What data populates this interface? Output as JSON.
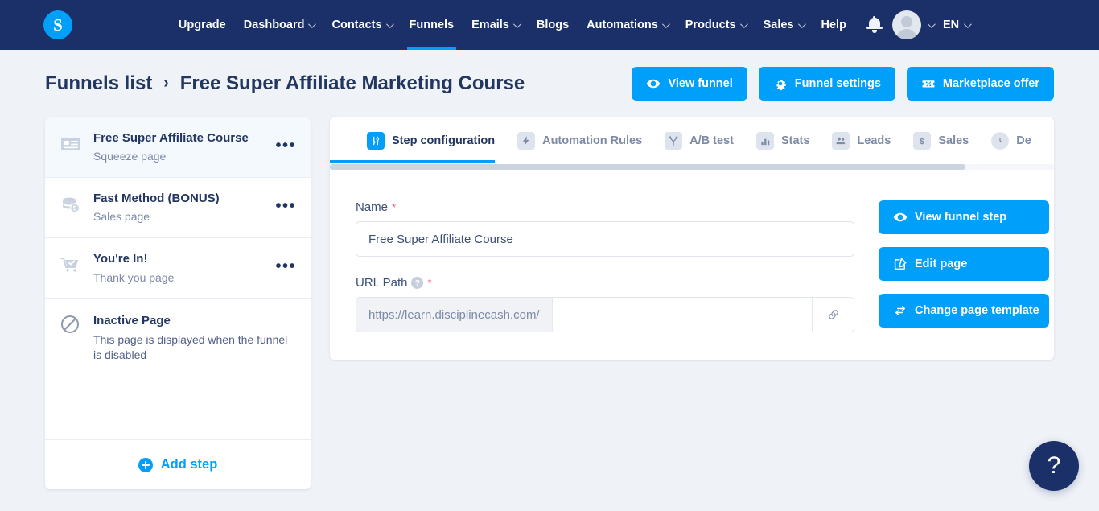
{
  "brand": {
    "logo_letter": "S",
    "accent": "#00a0fa",
    "header_bg": "#1b3068",
    "page_bg": "#eff2f7",
    "required_color": "#f4556c"
  },
  "topnav": {
    "items": [
      {
        "label": "Upgrade",
        "caret": false,
        "active": false
      },
      {
        "label": "Dashboard",
        "caret": true,
        "active": false
      },
      {
        "label": "Contacts",
        "caret": true,
        "active": false
      },
      {
        "label": "Funnels",
        "caret": false,
        "active": true
      },
      {
        "label": "Emails",
        "caret": true,
        "active": false
      },
      {
        "label": "Blogs",
        "caret": false,
        "active": false
      },
      {
        "label": "Automations",
        "caret": true,
        "active": false
      },
      {
        "label": "Products",
        "caret": true,
        "active": false
      },
      {
        "label": "Sales",
        "caret": true,
        "active": false
      },
      {
        "label": "Help",
        "caret": false,
        "active": false
      }
    ],
    "notifications_icon": "bell-icon",
    "avatar_icon": "avatar",
    "language": "EN"
  },
  "page_header": {
    "breadcrumb_root": "Funnels list",
    "breadcrumb_separator": "›",
    "breadcrumb_current": "Free Super Affiliate Marketing Course",
    "actions": [
      {
        "label": "View funnel",
        "icon": "eye-icon"
      },
      {
        "label": "Funnel settings",
        "icon": "gear-icon"
      },
      {
        "label": "Marketplace offer",
        "icon": "ticket-icon"
      }
    ]
  },
  "sidebar": {
    "steps": [
      {
        "title": "Free Super Affiliate Course",
        "subtitle": "Squeeze page",
        "icon": "squeeze-page-icon",
        "active": true,
        "menu": "•••"
      },
      {
        "title": "Fast Method (BONUS)",
        "subtitle": "Sales page",
        "icon": "sales-page-icon",
        "active": false,
        "menu": "•••"
      },
      {
        "title": "You're In!",
        "subtitle": "Thank you page",
        "icon": "thank-you-page-icon",
        "active": false,
        "menu": "•••"
      }
    ],
    "inactive": {
      "title": "Inactive Page",
      "subtitle": "This page is displayed when the funnel is disabled",
      "icon": "no-entry-icon"
    },
    "add_step_label": "Add step"
  },
  "tabs": [
    {
      "label": "Step configuration",
      "icon": "sliders-icon",
      "active": true
    },
    {
      "label": "Automation Rules",
      "icon": "bolt-icon",
      "active": false
    },
    {
      "label": "A/B test",
      "icon": "split-test-icon",
      "active": false
    },
    {
      "label": "Stats",
      "icon": "bar-chart-icon",
      "active": false
    },
    {
      "label": "Leads",
      "icon": "people-icon",
      "active": false
    },
    {
      "label": "Sales",
      "icon": "dollar-icon",
      "active": false
    },
    {
      "label": "De",
      "icon": "clock-icon",
      "active": false
    }
  ],
  "form": {
    "name": {
      "label": "Name",
      "required_marker": "*",
      "value": "Free Super Affiliate Course",
      "placeholder": "Name"
    },
    "url_path": {
      "label": "URL Path",
      "help_marker": "?",
      "required_marker": "*",
      "prefix": "https://learn.disciplinecash.com/",
      "value": "",
      "placeholder": "",
      "link_button_icon": "link-icon"
    }
  },
  "side_actions": [
    {
      "label": "View funnel step",
      "icon": "eye-icon"
    },
    {
      "label": "Edit page",
      "icon": "edit-square-icon"
    },
    {
      "label": "Change page template",
      "icon": "swap-arrows-icon"
    }
  ],
  "help_fab": {
    "label": "?"
  }
}
